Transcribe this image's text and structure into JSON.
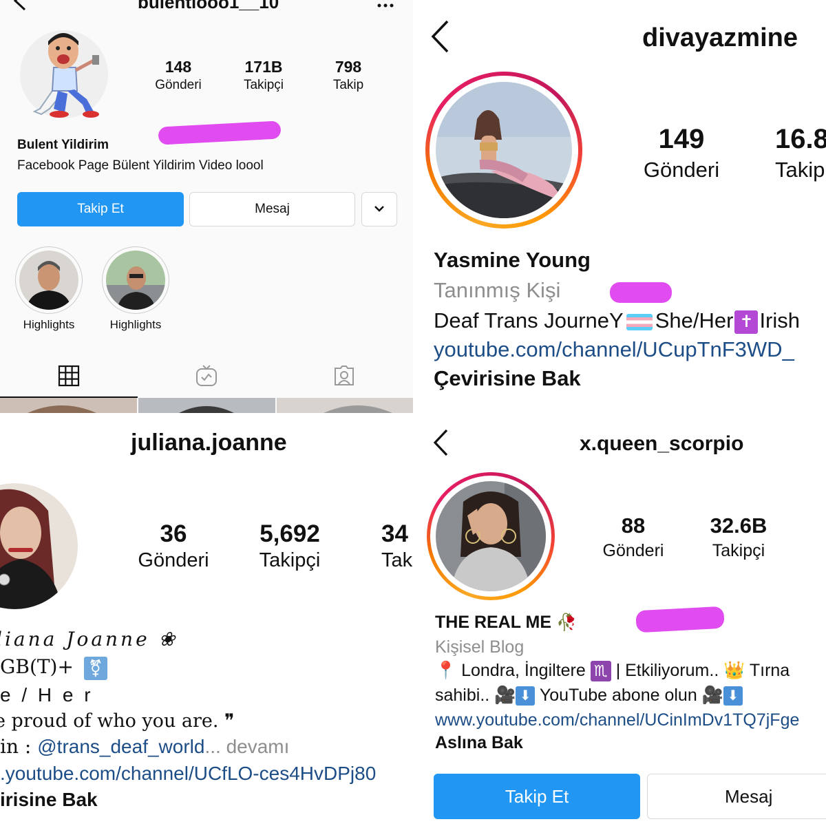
{
  "colors": {
    "accent": "#2196f3",
    "link": "#1d4d86",
    "highlight_mark": "#e04cf0"
  },
  "p1": {
    "username": "bulentlooo1__10",
    "more_icon": "more-dots-icon",
    "stats": [
      {
        "value": "148",
        "label": "Gönderi"
      },
      {
        "value": "171B",
        "label": "Takipçi"
      },
      {
        "value": "798",
        "label": "Takip"
      }
    ],
    "name": "Bulent Yildirim",
    "bio": "Facebook Page Bülent Yildirim Video loool",
    "follow_label": "Takip Et",
    "message_label": "Mesaj",
    "highlights": [
      {
        "label": "Highlights"
      },
      {
        "label": "Highlights"
      }
    ],
    "tabs": [
      "grid-icon",
      "igtv-icon",
      "tagged-icon"
    ]
  },
  "p2": {
    "username": "divayazmine",
    "stats": [
      {
        "value": "149",
        "label": "Gönderi"
      },
      {
        "value": "16.8",
        "label": "Takip"
      }
    ],
    "name": "Yasmine Young",
    "category": "Tanınmış Kişi",
    "bio_text1": "Deaf Trans JourneY",
    "bio_text2": "She/Her",
    "bio_text3": "Irish",
    "link": "youtube.com/channel/UCupTnF3WD_",
    "translate": "Çevirisine Bak"
  },
  "p3": {
    "username": "juliana.joanne",
    "stats": [
      {
        "value": "36",
        "label": "Gönderi"
      },
      {
        "value": "5,692",
        "label": "Takipçi"
      },
      {
        "value": "34",
        "label": "Tak"
      }
    ],
    "line1": "liana Joanne ❀",
    "line2": "GB(T)+",
    "line3": "e / H e r",
    "line4": "e proud of who you are. ❞",
    "line5_prefix": "in : ",
    "line5_mention": "@trans_deaf_world",
    "line5_suffix": "... devamı",
    "link": ".youtube.com/channel/UCfLO-ces4HvDPj80",
    "translate": "irisine Bak"
  },
  "p4": {
    "username": "x.queen_scorpio",
    "stats": [
      {
        "value": "88",
        "label": "Gönderi"
      },
      {
        "value": "32.6B",
        "label": "Takipçi"
      }
    ],
    "name": "THE REAL ME",
    "category": "Kişisel Blog",
    "bio_line1_a": "Londra, İngiltere",
    "bio_line1_b": "| Etkiliyorum..",
    "bio_line1_c": "Tırna",
    "bio_line2_a": "sahibi..",
    "bio_line2_b": "YouTube abone olun",
    "link": "www.youtube.com/channel/UCinImDv1TQ7jFge",
    "translate": "Aslına Bak",
    "follow_label": "Takip Et",
    "message_label": "Mesaj"
  }
}
